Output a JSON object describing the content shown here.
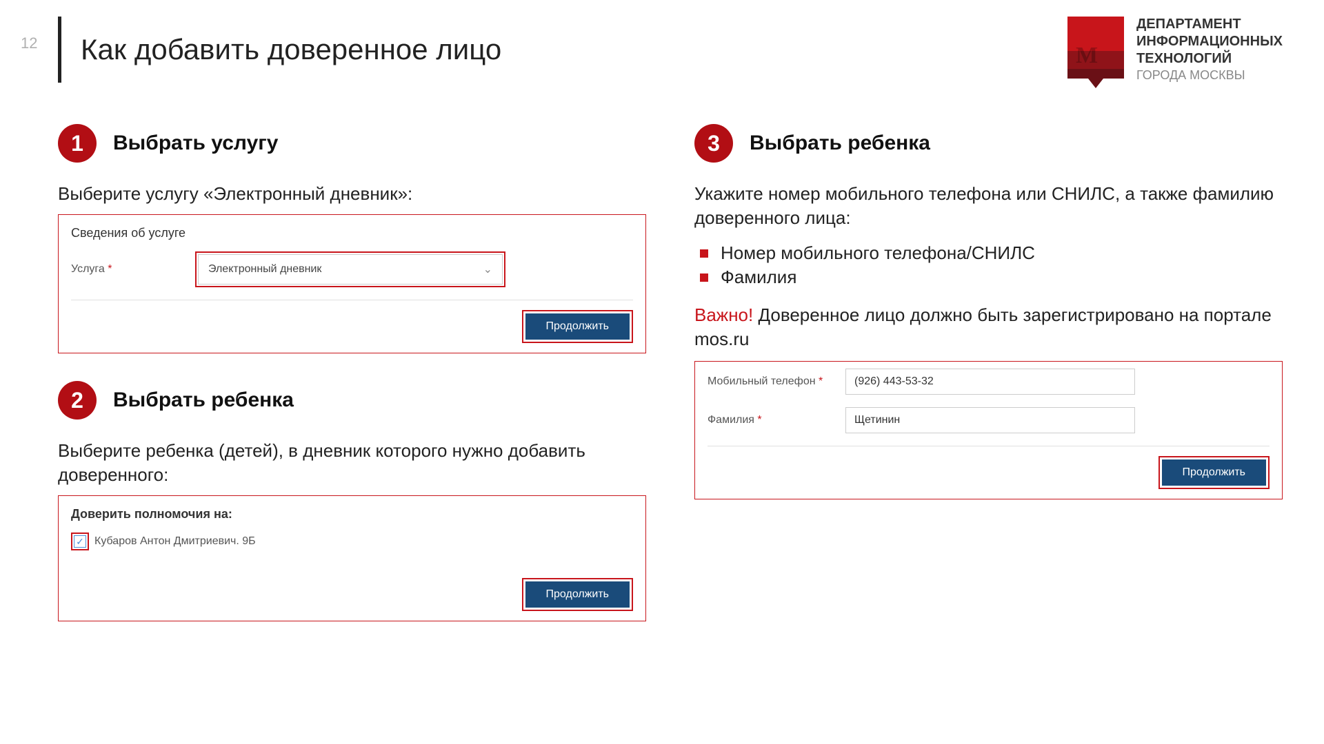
{
  "page_number": "12",
  "title": "Как добавить доверенное лицо",
  "logo": {
    "l1": "ДЕПАРТАМЕНТ",
    "l2": "ИНФОРМАЦИОННЫХ",
    "l3": "ТЕХНОЛОГИЙ",
    "l4": "ГОРОДА МОСКВЫ"
  },
  "step1": {
    "num": "1",
    "title": "Выбрать услугу",
    "instr": "Выберите услугу «Электронный дневник»:",
    "panel_title": "Сведения об услуге",
    "label": "Услуга",
    "value": "Электронный дневник",
    "btn": "Продолжить"
  },
  "step2": {
    "num": "2",
    "title": "Выбрать ребенка",
    "instr": "Выберите ребенка (детей), в дневник которого нужно добавить доверенного:",
    "panel_title": "Доверить полномочия на:",
    "child": "Кубаров Антон Дмитриевич. 9Б",
    "btn": "Продолжить"
  },
  "step3": {
    "num": "3",
    "title": "Выбрать ребенка",
    "instr": "Укажите номер мобильного телефона или СНИЛС, а также фамилию доверенного лица:",
    "bullet1": "Номер мобильного телефона/СНИЛС",
    "bullet2": "Фамилия",
    "warn_head": "Важно! ",
    "warn_body": "Доверенное лицо должно быть зарегистрировано на портале mos.ru",
    "phone_label": "Мобильный телефон",
    "phone_value": "(926) 443-53-32",
    "surname_label": "Фамилия",
    "surname_value": "Щетинин",
    "btn": "Продолжить"
  }
}
